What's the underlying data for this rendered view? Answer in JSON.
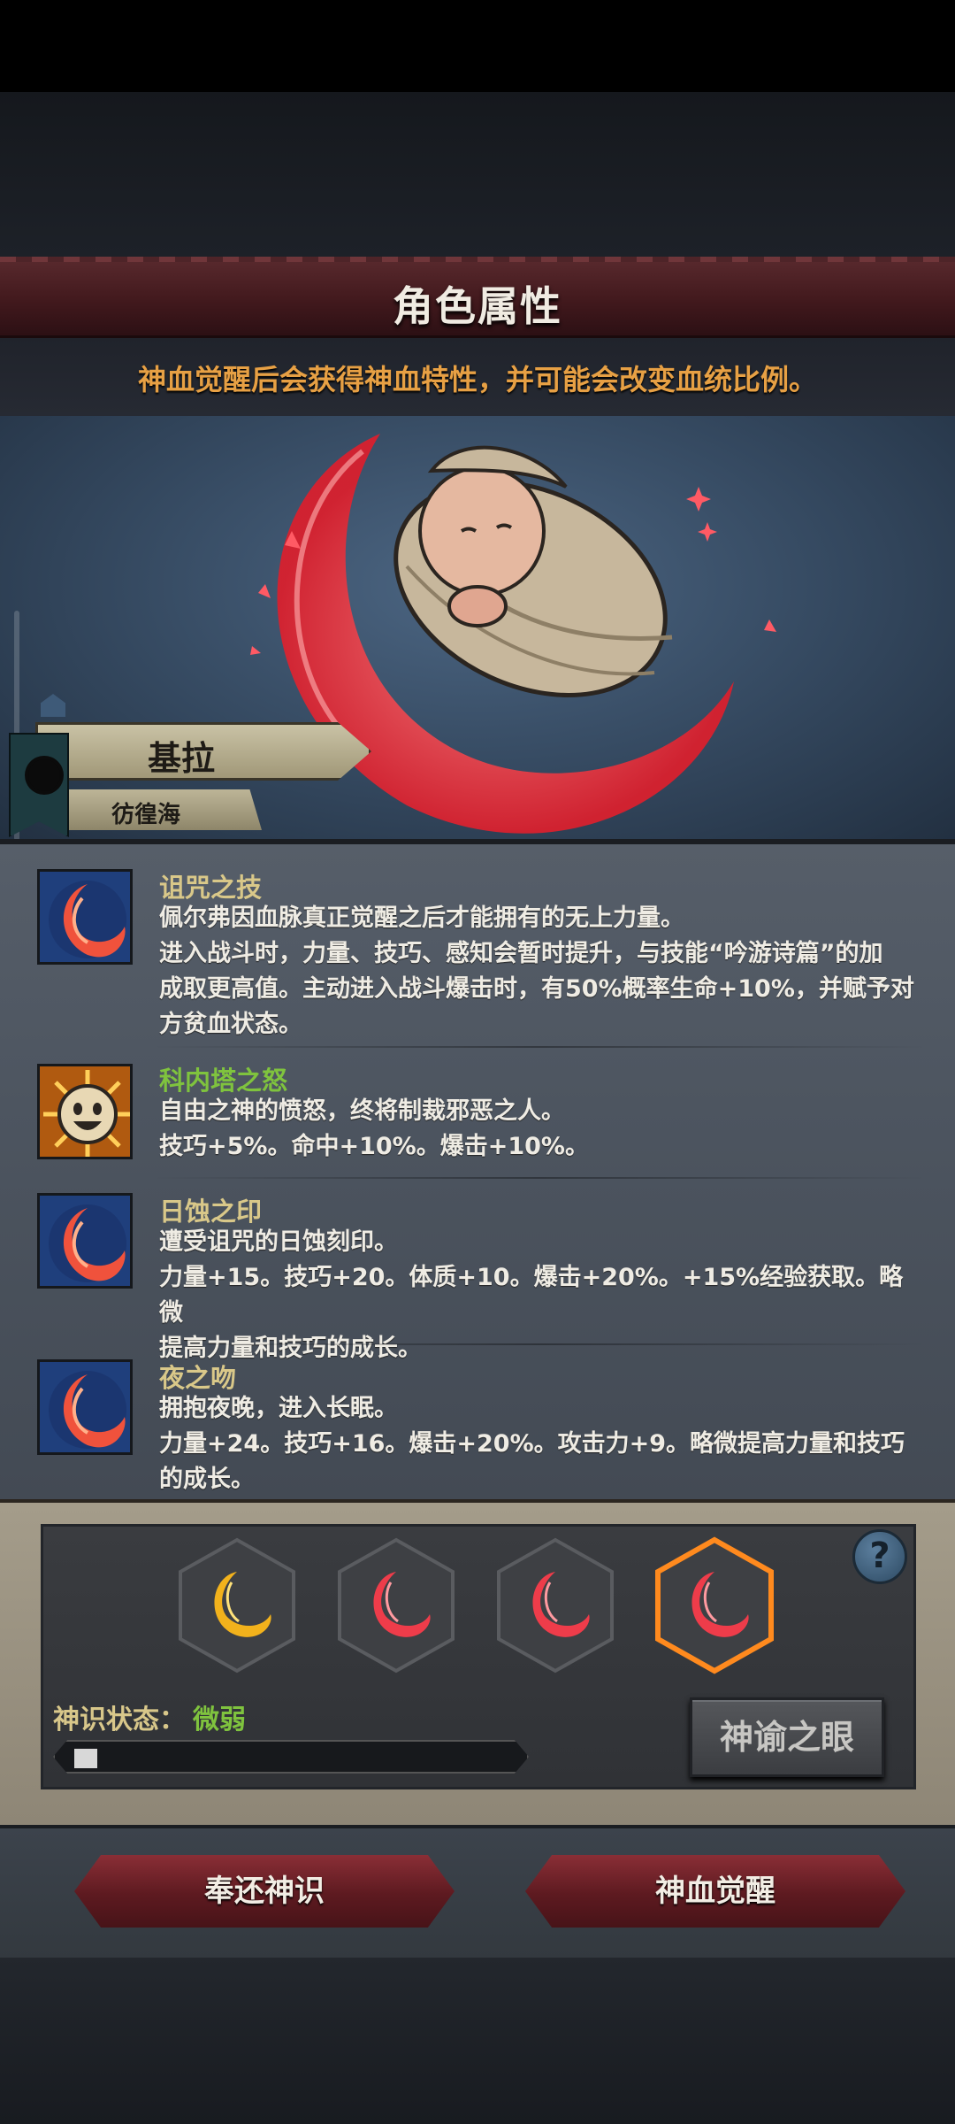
{
  "header": {
    "title": "角色属性",
    "subtitle": "神血觉醒后会获得神血特性，并可能会改变血统比例。"
  },
  "character": {
    "name": "基拉",
    "origin": "彷徨海"
  },
  "traits": [
    {
      "name": "诅咒之技",
      "icon": "crescent-icon",
      "lines": [
        "佩尔弗因血脉真正觉醒之后才能拥有的无上力量。",
        "进入战斗时，力量、技巧、感知会暂时提升，与技能“吟游诗篇”的加",
        "成取更高值。主动进入战斗爆击时，有50%概率生命+10%，并赋予对",
        "方贫血状态。"
      ]
    },
    {
      "name": "科内塔之怒",
      "icon": "smiling-sun-icon",
      "lines": [
        "自由之神的愤怒，终将制裁邪恶之人。",
        "技巧+5%。命中+10%。爆击+10%。"
      ]
    },
    {
      "name": "日蚀之印",
      "icon": "crescent-icon",
      "lines": [
        "遭受诅咒的日蚀刻印。",
        "力量+15。技巧+20。体质+10。爆击+20%。+15%经验获取。略微",
        "提高力量和技巧的成长。"
      ]
    },
    {
      "name": "夜之吻",
      "icon": "crescent-icon",
      "lines": [
        "拥抱夜晚，进入长眠。",
        "力量+24。技巧+16。爆击+20%。攻击力+9。略微提高力量和技巧",
        "的成长。"
      ]
    }
  ],
  "divine_panel": {
    "help_label": "?",
    "status_label": "神识状态：",
    "status_value": "微弱",
    "progress": 0.05,
    "eye_button": "神谕之眼",
    "slots": [
      "gold",
      "red",
      "red",
      "red-selected"
    ]
  },
  "actions": {
    "return_button": "奉还神识",
    "awaken_button": "神血觉醒"
  },
  "colors": {
    "title_band": "#4a1e22",
    "accent_orange": "#e7a044",
    "trait_name": "#d9c889",
    "trait_name_green": "#7fc33e",
    "selected_slot": "#ff8a1e"
  }
}
